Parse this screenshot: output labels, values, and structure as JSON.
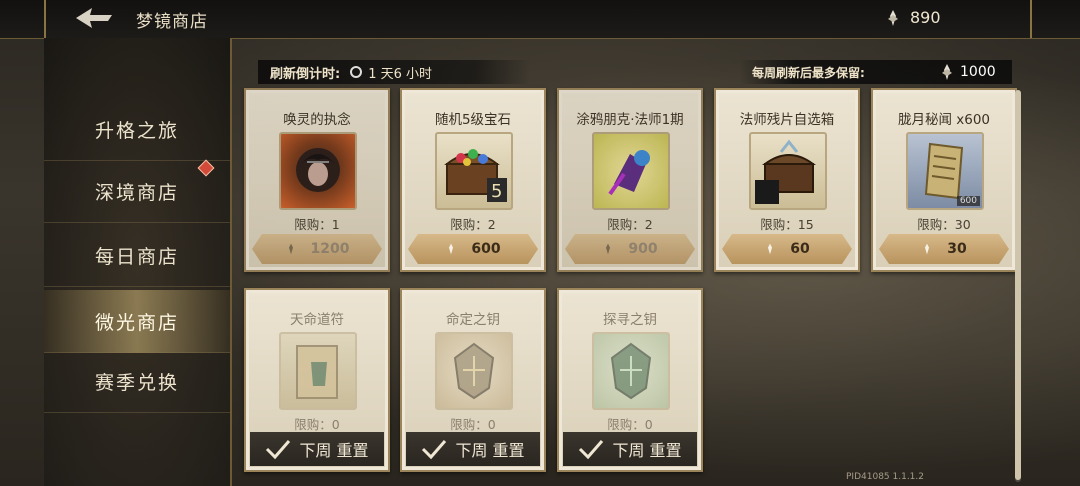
{
  "header": {
    "title": "梦镜商店",
    "currency_amount": "890"
  },
  "sidebar": {
    "items": [
      {
        "label": "升格之旅",
        "active": false
      },
      {
        "label": "深境商店",
        "active": false,
        "badge": true
      },
      {
        "label": "每日商店",
        "active": false
      },
      {
        "label": "微光商店",
        "active": true
      },
      {
        "label": "赛季兑换",
        "active": false
      }
    ]
  },
  "refresh": {
    "label": "刷新倒计时:",
    "time": "1 天6 小时"
  },
  "keep": {
    "label": "每周刷新后最多保留:",
    "amount": "1000"
  },
  "items": [
    {
      "name": "唤灵的执念",
      "limit": "限购：1",
      "price": "1200",
      "state": "dim"
    },
    {
      "name": "随机5级宝石",
      "limit": "限购：2",
      "price": "600",
      "state": "active"
    },
    {
      "name": "涂鸦朋克·法师1期",
      "limit": "限购：2",
      "price": "900",
      "state": "dim"
    },
    {
      "name": "法师残片自选箱",
      "limit": "限购：15",
      "price": "60",
      "state": "active"
    },
    {
      "name": "胧月秘闻 x600",
      "limit": "限购：30",
      "price": "30",
      "state": "active",
      "badge": "600"
    },
    {
      "name": "天命道符",
      "limit": "限购：0",
      "sold_label": "下周 重置",
      "state": "sold"
    },
    {
      "name": "命定之钥",
      "limit": "限购：0",
      "sold_label": "下周 重置",
      "state": "sold"
    },
    {
      "name": "探寻之钥",
      "limit": "限购：0",
      "sold_label": "下周 重置",
      "state": "sold"
    }
  ],
  "version": "PID41085 1.1.1.2",
  "colors": {
    "accent_gold": "#9c845a",
    "card_bg": "#ece4d2",
    "badge_red": "#d24b3a"
  }
}
